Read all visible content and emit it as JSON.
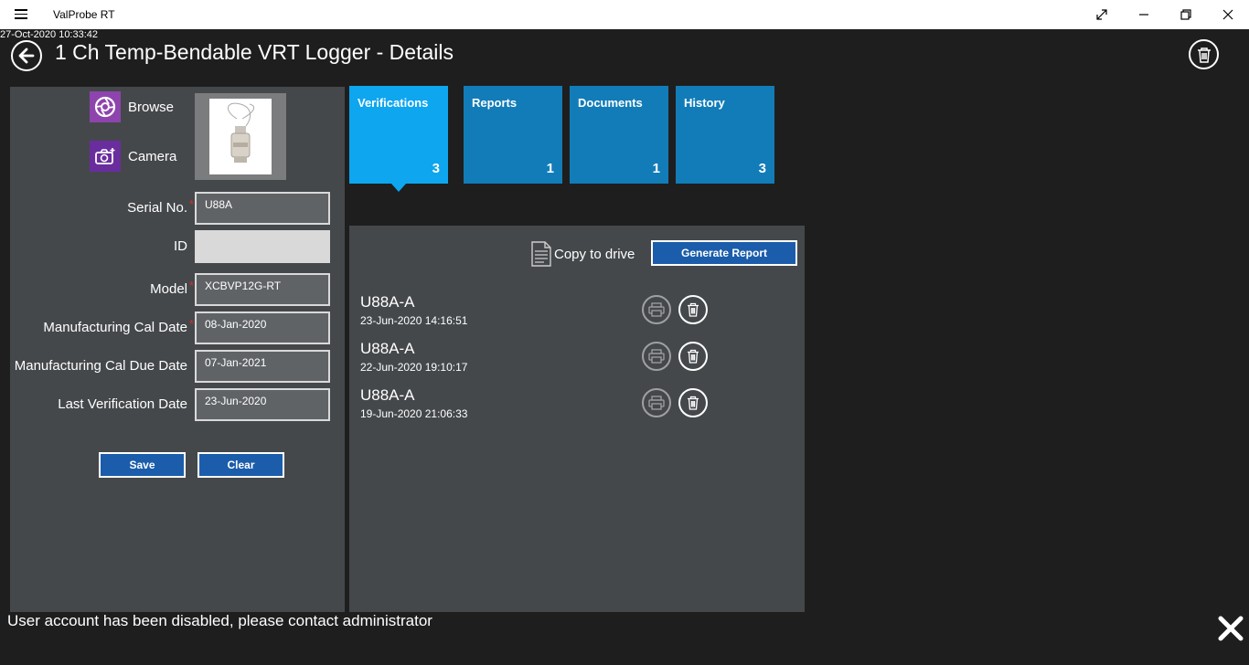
{
  "app": {
    "title": "ValProbe RT"
  },
  "timestamp": "27-Oct-2020 10:33:42",
  "page": {
    "title": "1 Ch Temp-Bendable VRT Logger - Details"
  },
  "picture": {
    "browse_label": "Browse",
    "camera_label": "Camera"
  },
  "fields": [
    {
      "label": "Serial No.",
      "required": true,
      "value": "U88A"
    },
    {
      "label": "ID",
      "required": false,
      "value": ""
    },
    {
      "label": "Model",
      "required": true,
      "value": "XCBVP12G-RT"
    },
    {
      "label": "Manufacturing Cal Date",
      "required": true,
      "value": "08-Jan-2020"
    },
    {
      "label": "Manufacturing Cal Due Date",
      "required": false,
      "value": "07-Jan-2021"
    },
    {
      "label": "Last Verification Date",
      "required": false,
      "value": "23-Jun-2020"
    }
  ],
  "form_buttons": {
    "save": "Save",
    "clear": "Clear"
  },
  "tiles": [
    {
      "label": "Verifications",
      "count": "3",
      "active": true
    },
    {
      "label": "Reports",
      "count": "1",
      "active": false
    },
    {
      "label": "Documents",
      "count": "1",
      "active": false
    },
    {
      "label": "History",
      "count": "3",
      "active": false
    }
  ],
  "panel": {
    "copy_to_drive": "Copy to drive",
    "generate_report": "Generate Report"
  },
  "verifications": [
    {
      "name": "U88A-A",
      "date": "23-Jun-2020 14:16:51"
    },
    {
      "name": "U88A-A",
      "date": "22-Jun-2020 19:10:17"
    },
    {
      "name": "U88A-A",
      "date": "19-Jun-2020 21:06:33"
    }
  ],
  "status": {
    "message": "User account has been disabled, please contact administrator"
  },
  "colors": {
    "accent": "#0da6ef",
    "tile": "#127cb8",
    "button": "#1b5dab",
    "required": "#d32f2f",
    "panel": "#45484b"
  },
  "icons": [
    "menu-icon",
    "maximize-icon",
    "minimize-icon",
    "restore-icon",
    "close-icon",
    "back-arrow-icon",
    "trash-icon",
    "browse-icon",
    "camera-icon",
    "document-icon",
    "printer-icon",
    "close-x-icon"
  ]
}
